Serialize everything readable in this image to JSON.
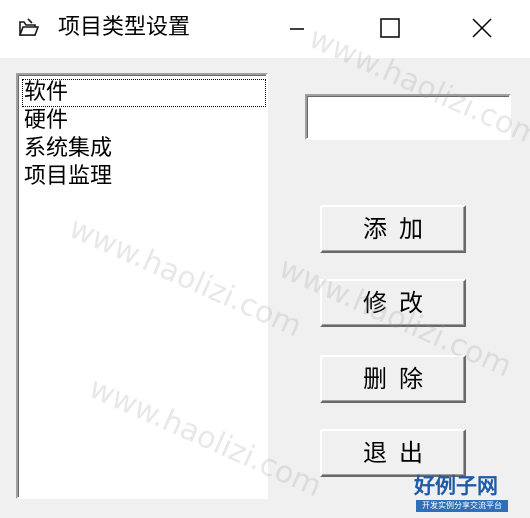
{
  "window": {
    "title": "项目类型设置",
    "app_icon": "form-window-icon",
    "controls": {
      "minimize_icon": "minimize-icon",
      "maximize_icon": "maximize-icon",
      "close_icon": "close-icon"
    }
  },
  "list": {
    "items": [
      {
        "label": "软件"
      },
      {
        "label": "硬件"
      },
      {
        "label": "系统集成"
      },
      {
        "label": "项目监理"
      }
    ],
    "focused_index": 0
  },
  "edit": {
    "value": ""
  },
  "buttons": {
    "add": "添加",
    "edit": "修改",
    "delete": "删除",
    "exit": "退出"
  },
  "watermark": {
    "text": "www.haolizi.com"
  },
  "logo": {
    "main": "好例子网",
    "sub": "开发实例分享交流平台"
  }
}
